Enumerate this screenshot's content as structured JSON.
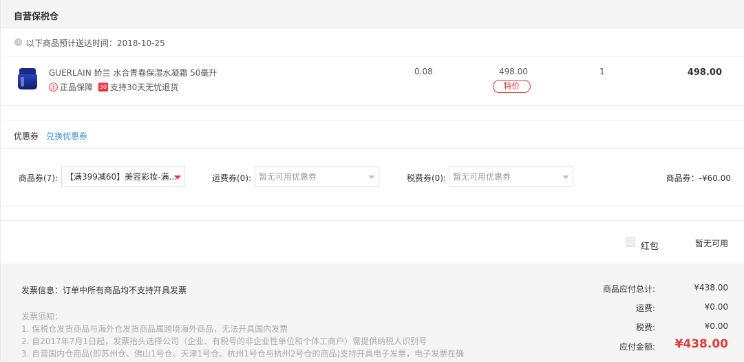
{
  "section": {
    "title": "自营保税仓"
  },
  "delivery": {
    "label": "以下商品预计送达时间：2018-10-25"
  },
  "product": {
    "name": "GUERLAIN 娇兰 水合青春保湿水凝霜 50毫升",
    "genuine_icon_text": "正",
    "genuine_label": "正品保障",
    "return_icon_text": "30",
    "return_label": "支持30天无忧退货",
    "tax_rate": "0.08",
    "unit_price": "498.00",
    "special_tag": "特价",
    "quantity": "1",
    "subtotal": "498.00"
  },
  "coupon": {
    "title": "优惠券",
    "redeem_link": "兑换优惠券",
    "goods_label": "商品券(7):",
    "goods_value": "【满399减60】美容彩妆-满...",
    "shipping_label": "运费券(0):",
    "shipping_value": "暂无可用优惠券",
    "tax_label": "税费券(0):",
    "tax_value": "暂无可用优惠券",
    "goods_discount": "商品券：-¥60.00"
  },
  "red_packet": {
    "label": "红包",
    "status": "暂无可用"
  },
  "invoice": {
    "info": "发票信息：订单中所有商品均不支持开具发票",
    "notice_title": "发票须知：",
    "notice_lines": [
      "1. 保税仓发货商品与海外仓发货商品属跨境海外商品，无法开具国内发票",
      "2. 自2017年7月1日起，发票抬头选择公司（企业、有税号的非企业性单位和个体工商户）需提供纳税人识别号",
      "3. 自营国内仓商品(即苏州仓、佛山1号仓、天津1号仓、杭州1号仓与杭州2号仓的商品)支持开具电子发票，电子发票在确"
    ]
  },
  "totals": {
    "goods_total_label": "商品应付总计:",
    "goods_total_value": "¥438.00",
    "shipping_label": "运费:",
    "shipping_value": "¥0.00",
    "tax_label": "税费:",
    "tax_value": "¥0.00",
    "payable_label": "应付金额:",
    "payable_value": "¥438.00"
  },
  "colors": {
    "accent_red": "#e4393c",
    "link_blue": "#3a93d6",
    "panel_grey": "#f5f5f5"
  }
}
